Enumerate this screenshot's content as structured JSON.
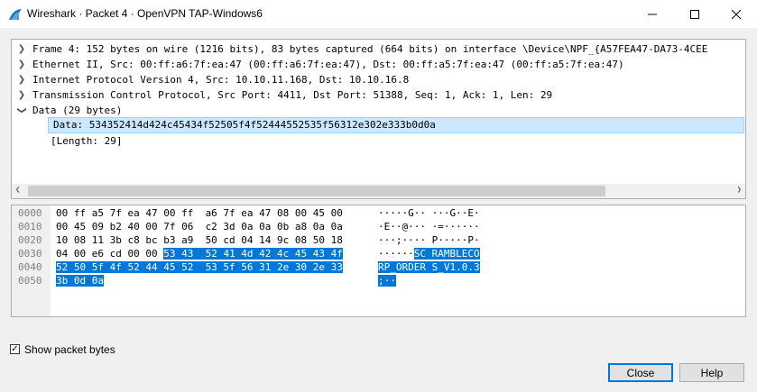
{
  "window": {
    "title": "Wireshark · Packet 4 · OpenVPN TAP-Windows6",
    "minimize_glyph": "—",
    "maximize_glyph": "☐",
    "close_glyph": "✕",
    "app_icon": "wireshark-fin-icon"
  },
  "tree": [
    {
      "label": "Frame 4: 152 bytes on wire (1216 bits), 83 bytes captured (664 bits) on interface \\Device\\NPF_{A57FEA47-DA73-4CEE",
      "expanded": false
    },
    {
      "label": "Ethernet II, Src: 00:ff:a6:7f:ea:47 (00:ff:a6:7f:ea:47), Dst: 00:ff:a5:7f:ea:47 (00:ff:a5:7f:ea:47)",
      "expanded": false
    },
    {
      "label": "Internet Protocol Version 4, Src: 10.10.11.168, Dst: 10.10.16.8",
      "expanded": false
    },
    {
      "label": "Transmission Control Protocol, Src Port: 4411, Dst Port: 51388, Seq: 1, Ack: 1, Len: 29",
      "expanded": false
    },
    {
      "label": "Data (29 bytes)",
      "expanded": true
    }
  ],
  "data_children": [
    {
      "label": "Data: 534352414d424c45434f52505f4f52444552535f56312e302e333b0d0a",
      "selected": true
    },
    {
      "label": "[Length: 29]",
      "selected": false
    }
  ],
  "bytes": [
    {
      "offset": "0000",
      "hex_plain": "00 ff a5 7f ea 47 00 ff  a6 7f ea 47 08 00 45 00",
      "hex_hl": "",
      "ascii_plain": "·····G·· ···G··E·",
      "ascii_hl": ""
    },
    {
      "offset": "0010",
      "hex_plain": "00 45 09 b2 40 00 7f 06  c2 3d 0a 0a 0b a8 0a 0a",
      "hex_hl": "",
      "ascii_plain": "·E··@··· ·=······",
      "ascii_hl": ""
    },
    {
      "offset": "0020",
      "hex_plain": "10 08 11 3b c8 bc b3 a9  50 cd 04 14 9c 08 50 18",
      "hex_hl": "",
      "ascii_plain": "···;···· P·····P·",
      "ascii_hl": ""
    },
    {
      "offset": "0030",
      "hex_plain": "04 00 e6 cd 00 00 ",
      "hex_hl": "53 43  52 41 4d 42 4c 45 43 4f",
      "ascii_plain": "······",
      "ascii_hl": "SC RAMBLECO"
    },
    {
      "offset": "0040",
      "hex_plain": "",
      "hex_hl": "52 50 5f 4f 52 44 45 52  53 5f 56 31 2e 30 2e 33",
      "ascii_plain": "",
      "ascii_hl": "RP_ORDER S_V1.0.3"
    },
    {
      "offset": "0050",
      "hex_plain": "",
      "hex_hl": "3b 0d 0a",
      "ascii_plain": "",
      "ascii_hl": ";··"
    }
  ],
  "options": {
    "show_packet_bytes_label": "Show packet bytes",
    "show_packet_bytes_checked": true,
    "check_glyph": "✓"
  },
  "buttons": {
    "close_label": "Close",
    "help_label": "Help"
  },
  "colors": {
    "selection": "#0078d7",
    "tree_selection": "#cce8ff",
    "focus_border": "#0078d7"
  }
}
